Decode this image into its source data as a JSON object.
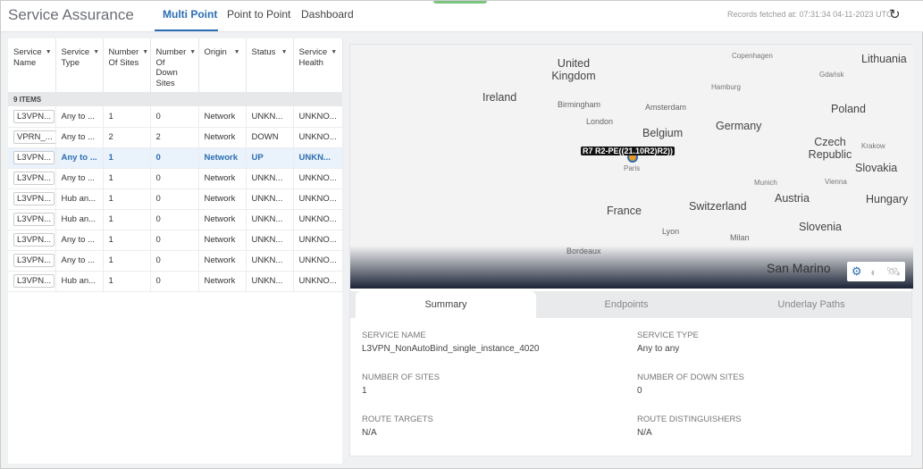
{
  "header": {
    "title": "Service Assurance",
    "tabs": [
      "Multi Point",
      "Point to Point",
      "Dashboard"
    ],
    "active_tab": "Multi Point",
    "fetched": "Records fetched at: 07:31:34 04-11-2023 UTC"
  },
  "table": {
    "columns": [
      "Service Name",
      "Service Type",
      "Number Of Sites",
      "Number Of Down Sites",
      "Origin",
      "Status",
      "Service Health"
    ],
    "count_label": "9 ITEMS",
    "rows": [
      [
        "L3VPN...",
        "Any to ...",
        "1",
        "0",
        "Network",
        "UNKN...",
        "UNKNO..."
      ],
      [
        "VPRN_...",
        "Any to ...",
        "2",
        "2",
        "Network",
        "DOWN",
        "UNKNO..."
      ],
      [
        "L3VPN...",
        "Any to ...",
        "1",
        "0",
        "Network",
        "UP",
        "UNKN..."
      ],
      [
        "L3VPN...",
        "Any to ...",
        "1",
        "0",
        "Network",
        "UNKN...",
        "UNKNO..."
      ],
      [
        "L3VPN...",
        "Hub an...",
        "1",
        "0",
        "Network",
        "UNKN...",
        "UNKNO..."
      ],
      [
        "L3VPN...",
        "Hub an...",
        "1",
        "0",
        "Network",
        "UNKN...",
        "UNKNO..."
      ],
      [
        "L3VPN...",
        "Any to ...",
        "1",
        "0",
        "Network",
        "UNKN...",
        "UNKNO..."
      ],
      [
        "L3VPN...",
        "Any to ...",
        "1",
        "0",
        "Network",
        "UNKN...",
        "UNKNO..."
      ],
      [
        "L3VPN...",
        "Hub an...",
        "1",
        "0",
        "Network",
        "UNKN...",
        "UNKNO..."
      ]
    ],
    "selected_index": 2
  },
  "map": {
    "labels": [
      "United Kingdom",
      "Ireland",
      "Lithuania",
      "Copenhagen",
      "Gdańsk",
      "Hamburg",
      "Birmingham",
      "Amsterdam",
      "Poland",
      "London",
      "Germany",
      "Belgium",
      "Czech Republic",
      "Krakow",
      "Paris",
      "Slovakia",
      "Munich",
      "Vienna",
      "France",
      "Switzerland",
      "Austria",
      "Hungary",
      "Lyon",
      "Slovenia",
      "Milan",
      "Bordeaux",
      "San Marino"
    ],
    "marker_label": "R7 R2-PE((21.10R2)R2))"
  },
  "details": {
    "tabs": [
      "Summary",
      "Endpoints",
      "Underlay Paths"
    ],
    "active_tab": "Summary",
    "fields": [
      {
        "label": "SERVICE NAME",
        "value": "L3VPN_NonAutoBind_single_instance_4020"
      },
      {
        "label": "SERVICE TYPE",
        "value": "Any to any"
      },
      {
        "label": "NUMBER OF SITES",
        "value": "1"
      },
      {
        "label": "NUMBER OF DOWN SITES",
        "value": "0"
      },
      {
        "label": "ROUTE TARGETS",
        "value": "N/A"
      },
      {
        "label": "ROUTE DISTINGUISHERS",
        "value": "N/A"
      }
    ]
  },
  "colors": {
    "accent": "#2c6db1",
    "marker": "#e69b24"
  }
}
